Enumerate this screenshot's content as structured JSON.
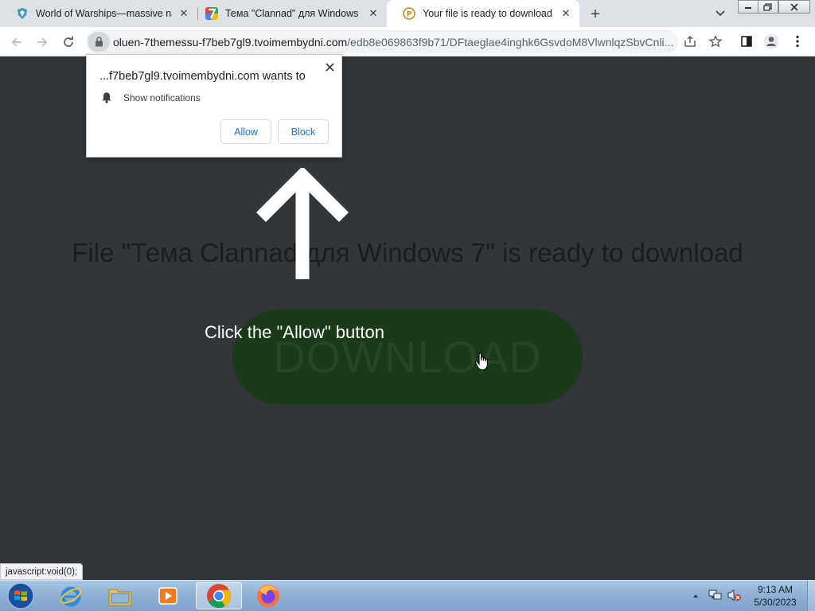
{
  "browser": {
    "tabs": [
      {
        "title": "World of Warships—massive naval",
        "close": "✕"
      },
      {
        "title": "Тема \"Clannad\" для Windows 7",
        "close": "✕"
      },
      {
        "title": "Your file is ready to download",
        "close": "✕"
      }
    ],
    "new_tab": "+",
    "url_host": "oluen-7themessu-f7beb7gl9.tvoimembydni.com",
    "url_path": "/edb8e069863f9b71/DFtaeglae4inghk6GsvdoM8VlwnlqzSbvCnli..."
  },
  "popup": {
    "title": "...f7beb7gl9.tvoimembydni.com wants to",
    "permission": "Show notifications",
    "allow_label": "Allow",
    "block_label": "Block"
  },
  "page": {
    "headline": "File \"Тема Clannad для Windows 7\" is ready to download",
    "download_label": "DOWNLOAD",
    "hint": "Click the \"Allow\" button"
  },
  "status_text": "javascript:void(0);",
  "taskbar": {
    "time": "9:13 AM",
    "date": "5/30/2023"
  }
}
